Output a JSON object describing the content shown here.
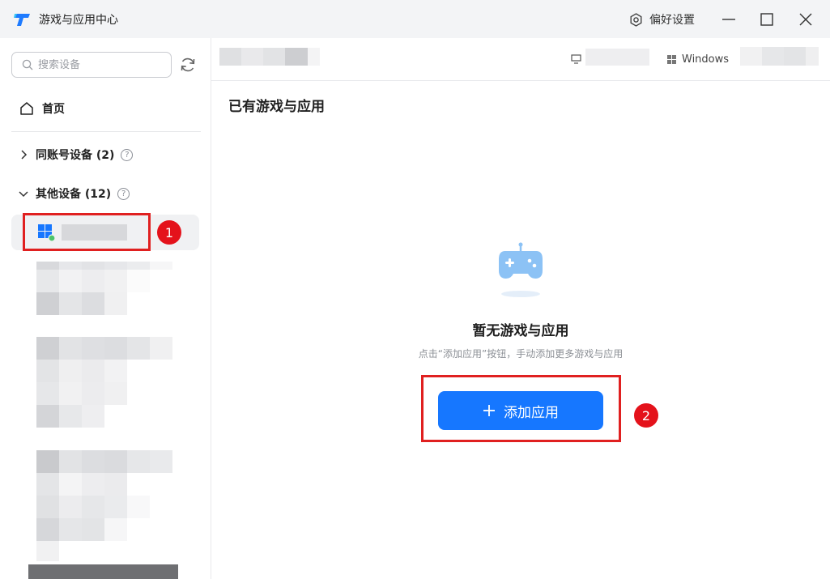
{
  "titlebar": {
    "title": "游戏与应用中心",
    "preferences_label": "偏好设置"
  },
  "sidebar": {
    "search_placeholder": "搜索设备",
    "home_label": "首页",
    "groups": [
      {
        "label": "同账号设备 (2)",
        "expanded": false
      },
      {
        "label": "其他设备 (12)",
        "expanded": true
      }
    ]
  },
  "main": {
    "os_label": "Windows",
    "section_title": "已有游戏与应用",
    "empty_title": "暂无游戏与应用",
    "empty_desc": "点击“添加应用”按钮，手动添加更多游戏与应用",
    "add_button_label": "添加应用"
  },
  "annotations": {
    "step1": "1",
    "step2": "2"
  },
  "colors": {
    "accent": "#1677ff",
    "annotation": "#e02020",
    "titlebar_bg": "#f3f4f6",
    "online_dot": "#4cc36a"
  }
}
